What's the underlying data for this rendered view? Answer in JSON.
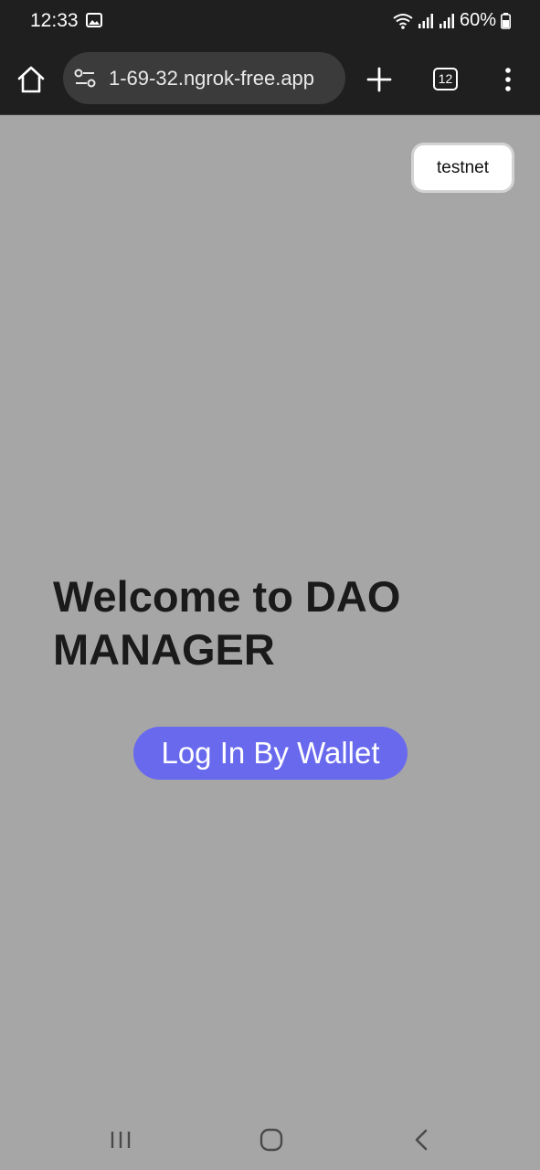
{
  "status_bar": {
    "time": "12:33",
    "battery": "60%",
    "icons": [
      "image-notification-icon",
      "wifi-icon",
      "signal-icon",
      "signal-icon",
      "battery-icon"
    ]
  },
  "browser": {
    "url": "1-69-32.ngrok-free.app",
    "tab_count": "12",
    "icons": [
      "home-icon",
      "site-settings-icon",
      "plus-icon",
      "tabs-icon",
      "more-vert-icon"
    ]
  },
  "page": {
    "network_label": "testnet",
    "title": "Welcome to DAO MANAGER",
    "login_button": "Log In By Wallet"
  },
  "colors": {
    "page_background": "#a6a6a6",
    "chrome_background": "#1f1f1f",
    "url_pill": "#3b3b3b",
    "login_button": "#6969ee"
  },
  "nav_bar": {
    "icons": [
      "recent-apps-icon",
      "home-circle-icon",
      "back-icon"
    ]
  }
}
